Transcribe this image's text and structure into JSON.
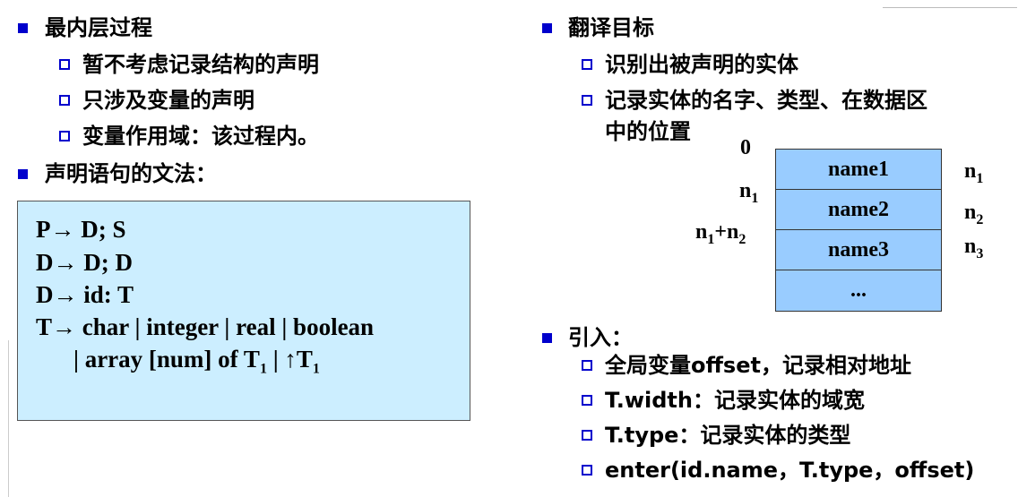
{
  "left": {
    "heading1": "最内层过程",
    "sub_items": [
      "暂不考虑记录结构的声明",
      "只涉及变量的声明",
      "变量作用域：该过程内。"
    ],
    "heading2": "声明语句的文法："
  },
  "grammar": {
    "line1": "P→ D; S",
    "line2": "D→ D; D",
    "line3": "D→ id: T",
    "line4": "T→ char | integer | real | boolean",
    "line5_text": "| array [num] of T",
    "line5_sub": "1",
    "line5_sep": " | ",
    "line5_arrow": "↑",
    "line5_t": "T",
    "line5_sub2": "1"
  },
  "right": {
    "heading1": "翻译目标",
    "sub1": "识别出被声明的实体",
    "sub2_line1": "记录实体的名字、类型、在数据区",
    "sub2_line2": "中的位置",
    "heading2": "引入：",
    "items": [
      "全局变量offset，记录相对地址",
      "T.width：记录实体的域宽",
      "T.type：记录实体的类型",
      "enter(id.name，T.type，offset)"
    ]
  },
  "memory": {
    "cells": [
      "name1",
      "name2",
      "name3",
      "..."
    ],
    "left_labels": {
      "zero": "0",
      "n1_base": "n",
      "n1_sub": "1",
      "n1n2_a": "n",
      "n1n2_a_sub": "1",
      "n1n2_plus": "+n",
      "n1n2_b_sub": "2"
    },
    "right_labels": [
      {
        "base": "n",
        "sub": "1"
      },
      {
        "base": "n",
        "sub": "2"
      },
      {
        "base": "n",
        "sub": "3"
      }
    ]
  },
  "colors": {
    "bullet": "#0000cc",
    "grammar_bg": "#cceeff",
    "memory_bg": "#99ccff"
  }
}
